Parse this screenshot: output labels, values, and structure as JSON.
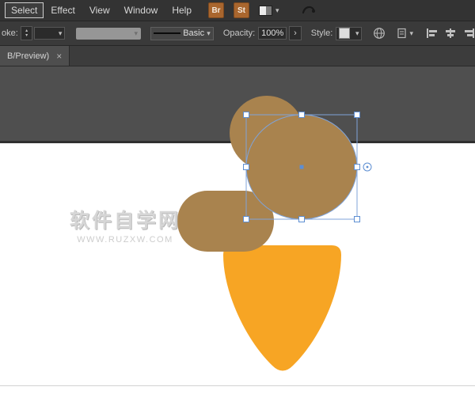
{
  "menubar": {
    "items": [
      "Select",
      "Effect",
      "View",
      "Window",
      "Help"
    ],
    "brushes_label": "Br",
    "styles_label": "St"
  },
  "controlbar": {
    "stroke_label": "oke:",
    "brush_name": "Basic",
    "opacity_label": "Opacity:",
    "opacity_value": "100%",
    "style_label": "Style:"
  },
  "tab": {
    "label": "B/Preview)"
  },
  "watermark": {
    "line1": "软件自学网",
    "line2": "WWW.RUZXW.COM"
  },
  "icons": {
    "chevron_down": "▾",
    "close": "×",
    "more": "›",
    "spinner_up": "▴",
    "spinner_down": "▾"
  },
  "colors": {
    "brown": "#A9834E",
    "orange": "#F7A524",
    "selection": "#5D8ED2",
    "selection_light": "#7FA3D9",
    "pasteboard": "#4F4F4F"
  }
}
